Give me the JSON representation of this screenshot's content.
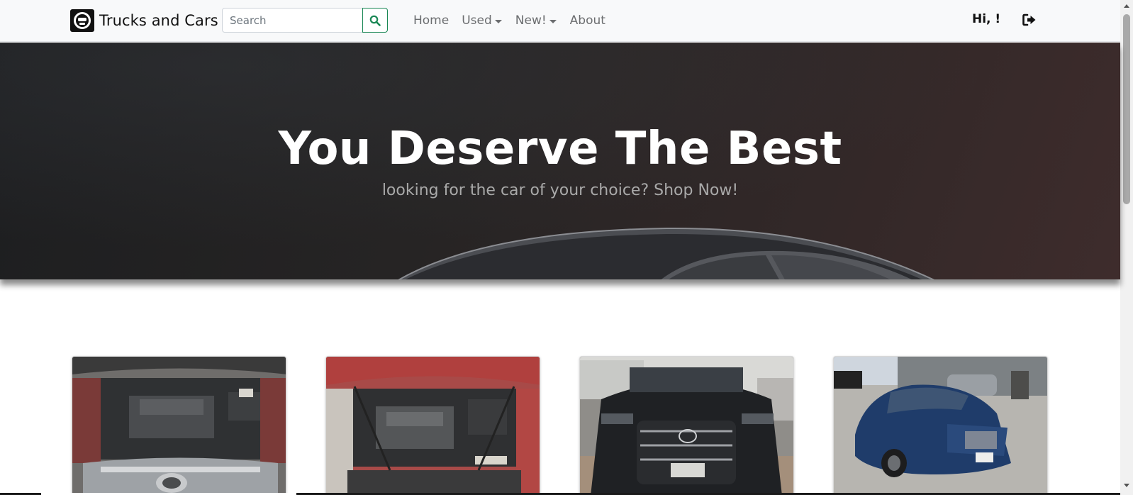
{
  "brand": {
    "name": "Trucks and Cars",
    "logo_icon": "steering-wheel-icon"
  },
  "search": {
    "placeholder": "Search",
    "value": "",
    "button_icon": "search-icon",
    "accent": "#198754"
  },
  "nav": {
    "items": [
      {
        "label": "Home",
        "dropdown": false
      },
      {
        "label": "Used",
        "dropdown": true
      },
      {
        "label": "New!",
        "dropdown": true
      },
      {
        "label": "About",
        "dropdown": false
      }
    ]
  },
  "user": {
    "greeting": "Hi, !",
    "logout_icon": "sign-out-icon"
  },
  "hero": {
    "title": "You Deserve The Best",
    "subtitle": "looking for the car of your choice? Shop Now!"
  },
  "cards": [
    {
      "image": "engine-bay-toyota-highlander-photo"
    },
    {
      "image": "engine-bay-red-sedan-photo"
    },
    {
      "image": "black-lexus-suv-photo"
    },
    {
      "image": "blue-hyundai-sonata-photo"
    }
  ]
}
